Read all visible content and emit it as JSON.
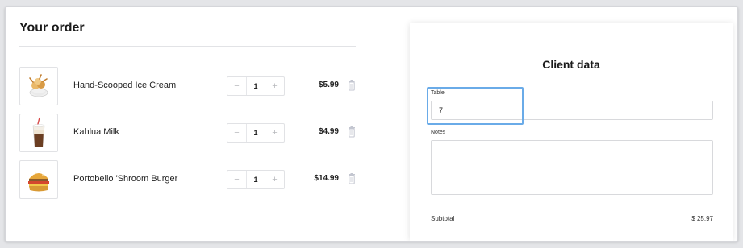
{
  "order": {
    "title": "Your order",
    "items": [
      {
        "name": "Hand-Scooped Ice Cream",
        "quantity": "1",
        "price": "$5.99",
        "thumbnail_icon": "ice-cream-icon"
      },
      {
        "name": "Kahlua Milk",
        "quantity": "1",
        "price": "$4.99",
        "thumbnail_icon": "milk-drink-icon"
      },
      {
        "name": "Portobello 'Shroom Burger",
        "quantity": "1",
        "price": "$14.99",
        "thumbnail_icon": "burger-icon"
      }
    ],
    "decrement_symbol": "−",
    "increment_symbol": "+"
  },
  "client": {
    "title": "Client data",
    "table_label": "Table",
    "table_value": "7",
    "notes_label": "Notes",
    "notes_value": "",
    "subtotal_label": "Subtotal",
    "subtotal_value": "$ 25.97"
  },
  "colors": {
    "focus_ring": "#6aabe8",
    "border": "#e1e2e5",
    "text": "#222222"
  }
}
